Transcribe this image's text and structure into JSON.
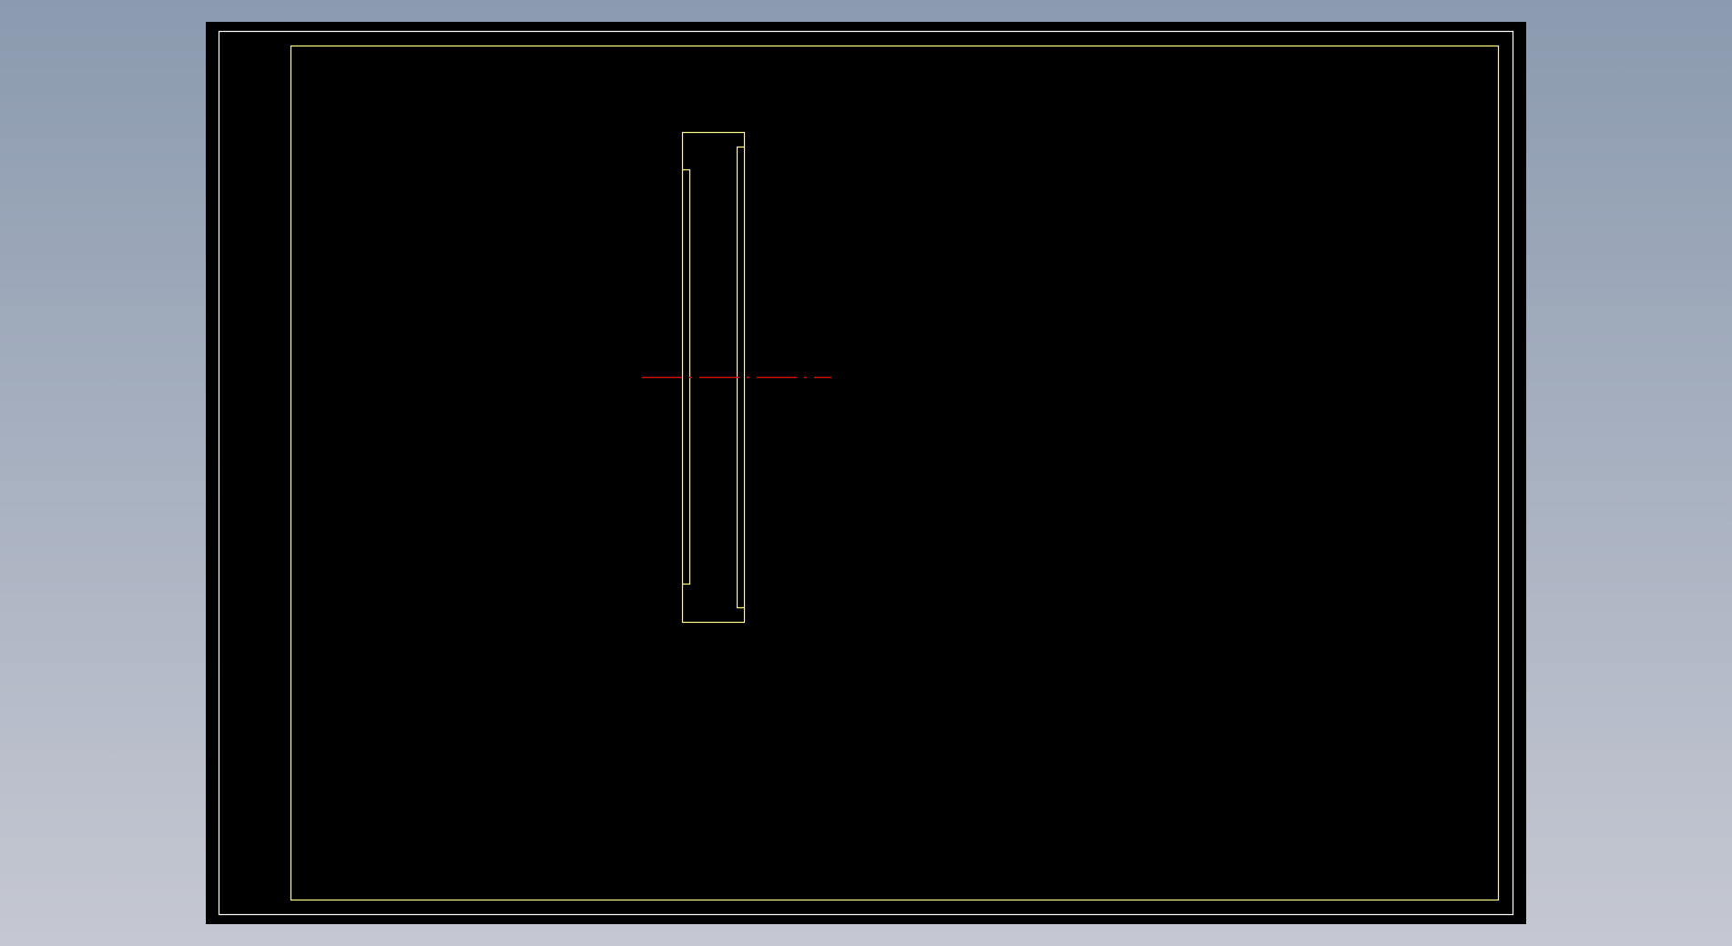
{
  "viewport": {
    "background_top": "#8b9aaf",
    "background_bottom": "#c5c8d2"
  },
  "sheet": {
    "fill": "#000000",
    "outer_border_color": "#ffffff",
    "inner_frame_color": "#ffff88"
  },
  "part": {
    "outline_color": "#ffff88"
  },
  "centerline": {
    "color": "#cc1010",
    "style": "dash-dot"
  }
}
